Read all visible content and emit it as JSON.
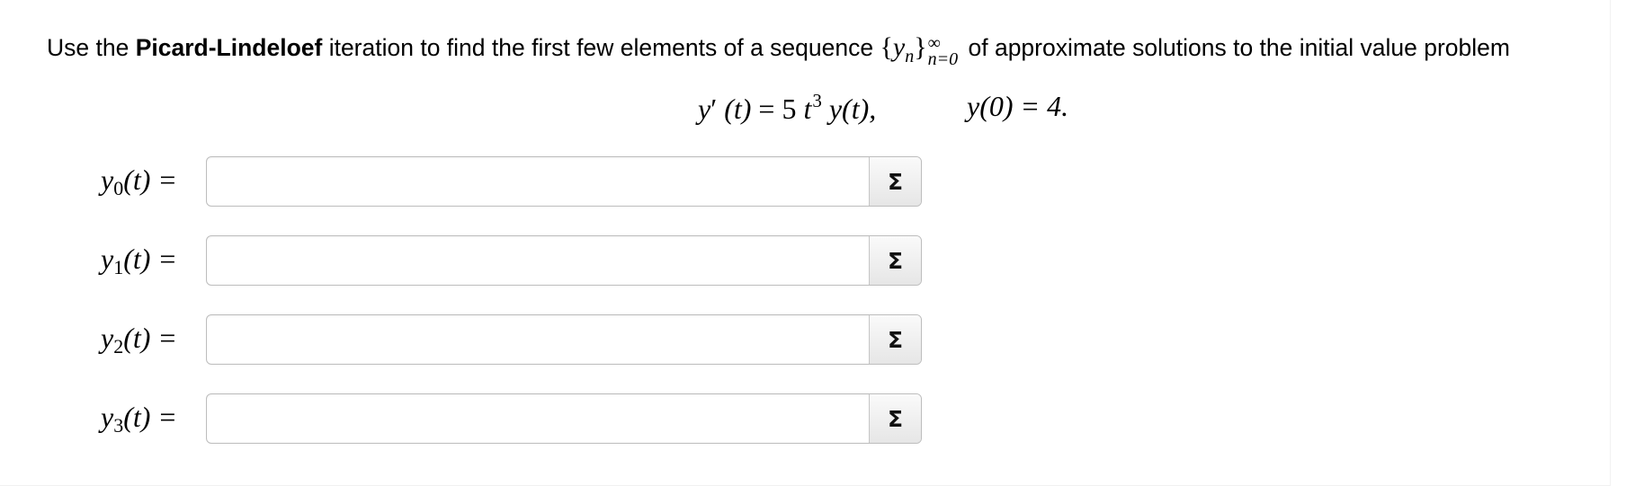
{
  "prompt": {
    "pre": "Use the ",
    "bold": "Picard-Lindeloef",
    "mid": " iteration to find the first few elements of a sequence ",
    "seq_open": "{",
    "seq_var": "y",
    "seq_index": "n",
    "seq_close": "}",
    "seq_upper": "∞",
    "seq_lower": "n=0",
    "post": " of approximate solutions to the initial value problem"
  },
  "equation": {
    "lhs_var": "y",
    "lhs_prime": "′",
    "lhs_arg": " (t)",
    "equals": " = ",
    "coef": "5",
    "t": " t",
    "power": "3",
    "rhs_rest": " y(t),",
    "init": "y(0) = 4."
  },
  "rows": [
    {
      "var": "y",
      "sub": "0",
      "arg": "(t)",
      "eq": "=",
      "value": "",
      "placeholder": ""
    },
    {
      "var": "y",
      "sub": "1",
      "arg": "(t)",
      "eq": "=",
      "value": "",
      "placeholder": ""
    },
    {
      "var": "y",
      "sub": "2",
      "arg": "(t)",
      "eq": "=",
      "value": "",
      "placeholder": ""
    },
    {
      "var": "y",
      "sub": "3",
      "arg": "(t)",
      "eq": "=",
      "value": "",
      "placeholder": ""
    }
  ],
  "math_button": {
    "label": "Σ",
    "icon": "sigma-icon"
  }
}
